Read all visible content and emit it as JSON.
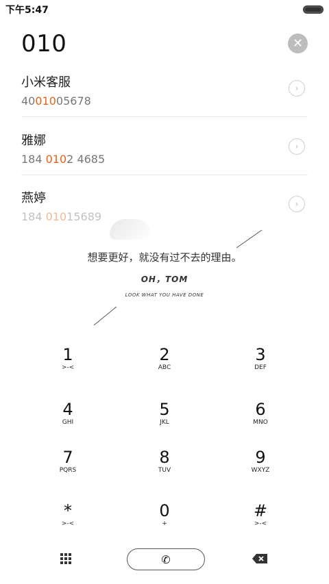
{
  "status_bar": {
    "time": "下午5:47"
  },
  "dialer": {
    "query": "010",
    "contacts": [
      {
        "name": "小米客服",
        "number_pre": "40",
        "number_match": "010",
        "number_post": "05678"
      },
      {
        "name": "雅娜",
        "number_pre": "184 ",
        "number_match": "010",
        "number_post": "2 4685"
      },
      {
        "name": "燕婷",
        "number_pre": "184 ",
        "number_match": "010",
        "number_post": "15689"
      }
    ]
  },
  "wallpaper_quote": {
    "line1": "想要更好，就没有过不去的理由。",
    "line2": "OH，TOM",
    "line3": "LOOK WHAT YOU HAVE DONE"
  },
  "keypad": {
    "keys": [
      {
        "num": "1",
        "letters": ">-<"
      },
      {
        "num": "2",
        "letters": "ABC"
      },
      {
        "num": "3",
        "letters": "DEF"
      },
      {
        "num": "4",
        "letters": "GHI"
      },
      {
        "num": "5",
        "letters": "JKL"
      },
      {
        "num": "6",
        "letters": "MNO"
      },
      {
        "num": "7",
        "letters": "PQRS"
      },
      {
        "num": "8",
        "letters": "TUV"
      },
      {
        "num": "9",
        "letters": "WXYZ"
      },
      {
        "num": "*",
        "letters": ">-<"
      },
      {
        "num": "0",
        "letters": "+"
      },
      {
        "num": "#",
        "letters": ">-<"
      }
    ]
  },
  "icons": {
    "clear": "close-icon",
    "contact_arrow": "chevron-right-icon",
    "dialpad": "dialpad-icon",
    "call": "phone-icon",
    "backspace": "backspace-icon"
  },
  "colors": {
    "match_highlight": "#e0641e"
  }
}
